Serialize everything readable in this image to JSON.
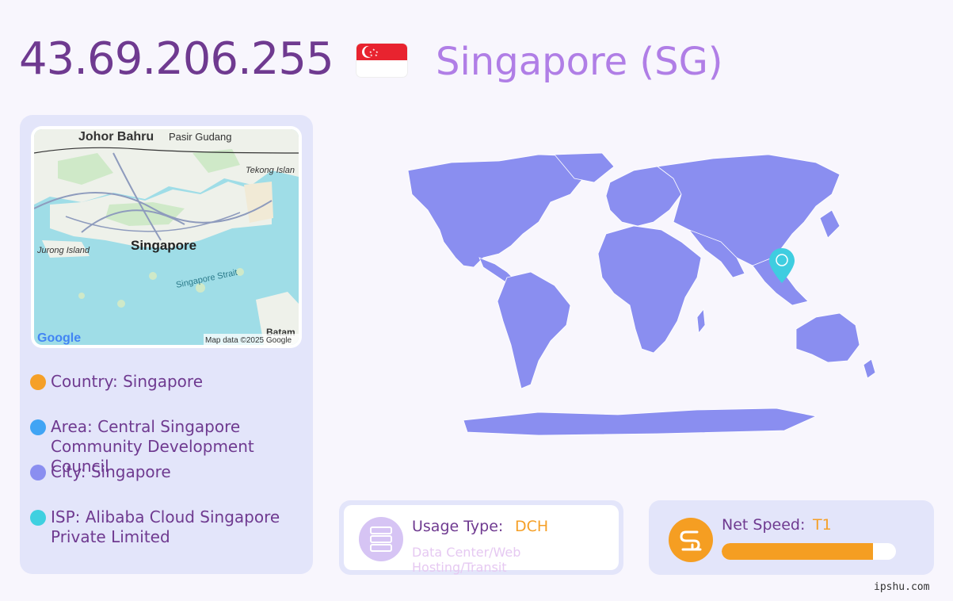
{
  "ip": "43.69.206.255",
  "country_title": "Singapore (SG)",
  "map": {
    "labels": {
      "johor": "Johor Bahru",
      "pasir": "Pasir Gudang",
      "tekong": "Tekong Islan",
      "jurong": "Jurong Island",
      "singapore": "Singapore",
      "strait": "Singapore Strait",
      "batam": "Batam",
      "google": "Google",
      "mapdata": "Map data ©2025 Google"
    }
  },
  "info": {
    "country": "Country: Singapore",
    "area": "Area: Central Singapore Community Development Council",
    "city": "City: Singapore",
    "isp": "ISP: Alibaba Cloud Singapore Private Limited"
  },
  "colors": {
    "country_dot": "#f5a028",
    "area_dot": "#40a4f4",
    "city_dot": "#8a8ef0",
    "isp_dot": "#3fd0e0",
    "landmass": "#8a8ef0",
    "pin": "#3fcde0"
  },
  "usage": {
    "label": "Usage Type:",
    "value": "DCH",
    "desc": "Data Center/Web Hosting/Transit",
    "icon": "server-icon"
  },
  "speed": {
    "label": "Net Speed:",
    "value": "T1",
    "level": 0.87,
    "icon": "speed-icon"
  },
  "footer": "ipshu.com"
}
